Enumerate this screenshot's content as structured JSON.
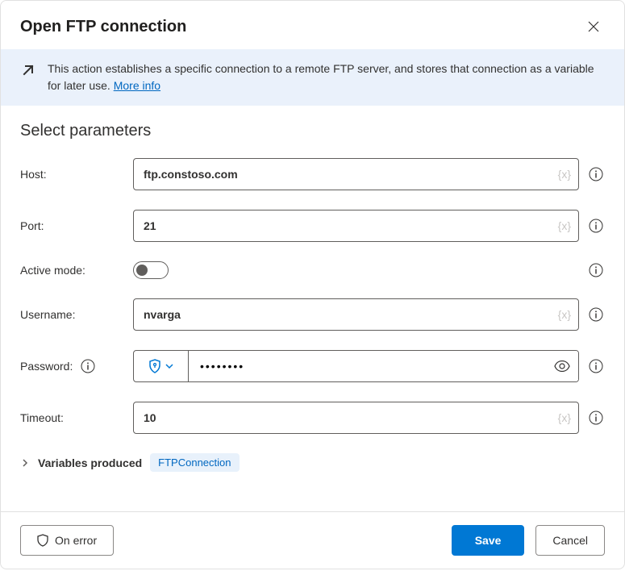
{
  "dialog": {
    "title": "Open FTP connection"
  },
  "banner": {
    "text_prefix": "This action establishes a specific connection to a remote FTP server, and stores that connection as a variable for later use. ",
    "link_text": "More info"
  },
  "section": {
    "title": "Select parameters"
  },
  "fields": {
    "host": {
      "label": "Host:",
      "value": "ftp.constoso.com",
      "var_hint": "{x}"
    },
    "port": {
      "label": "Port:",
      "value": "21",
      "var_hint": "{x}"
    },
    "active_mode": {
      "label": "Active mode:",
      "value": false
    },
    "username": {
      "label": "Username:",
      "value": "nvarga",
      "var_hint": "{x}"
    },
    "password": {
      "label": "Password:",
      "value": "••••••••"
    },
    "timeout": {
      "label": "Timeout:",
      "value": "10",
      "var_hint": "{x}"
    }
  },
  "variables": {
    "label": "Variables produced",
    "chip": "FTPConnection"
  },
  "footer": {
    "on_error": "On error",
    "save": "Save",
    "cancel": "Cancel"
  }
}
